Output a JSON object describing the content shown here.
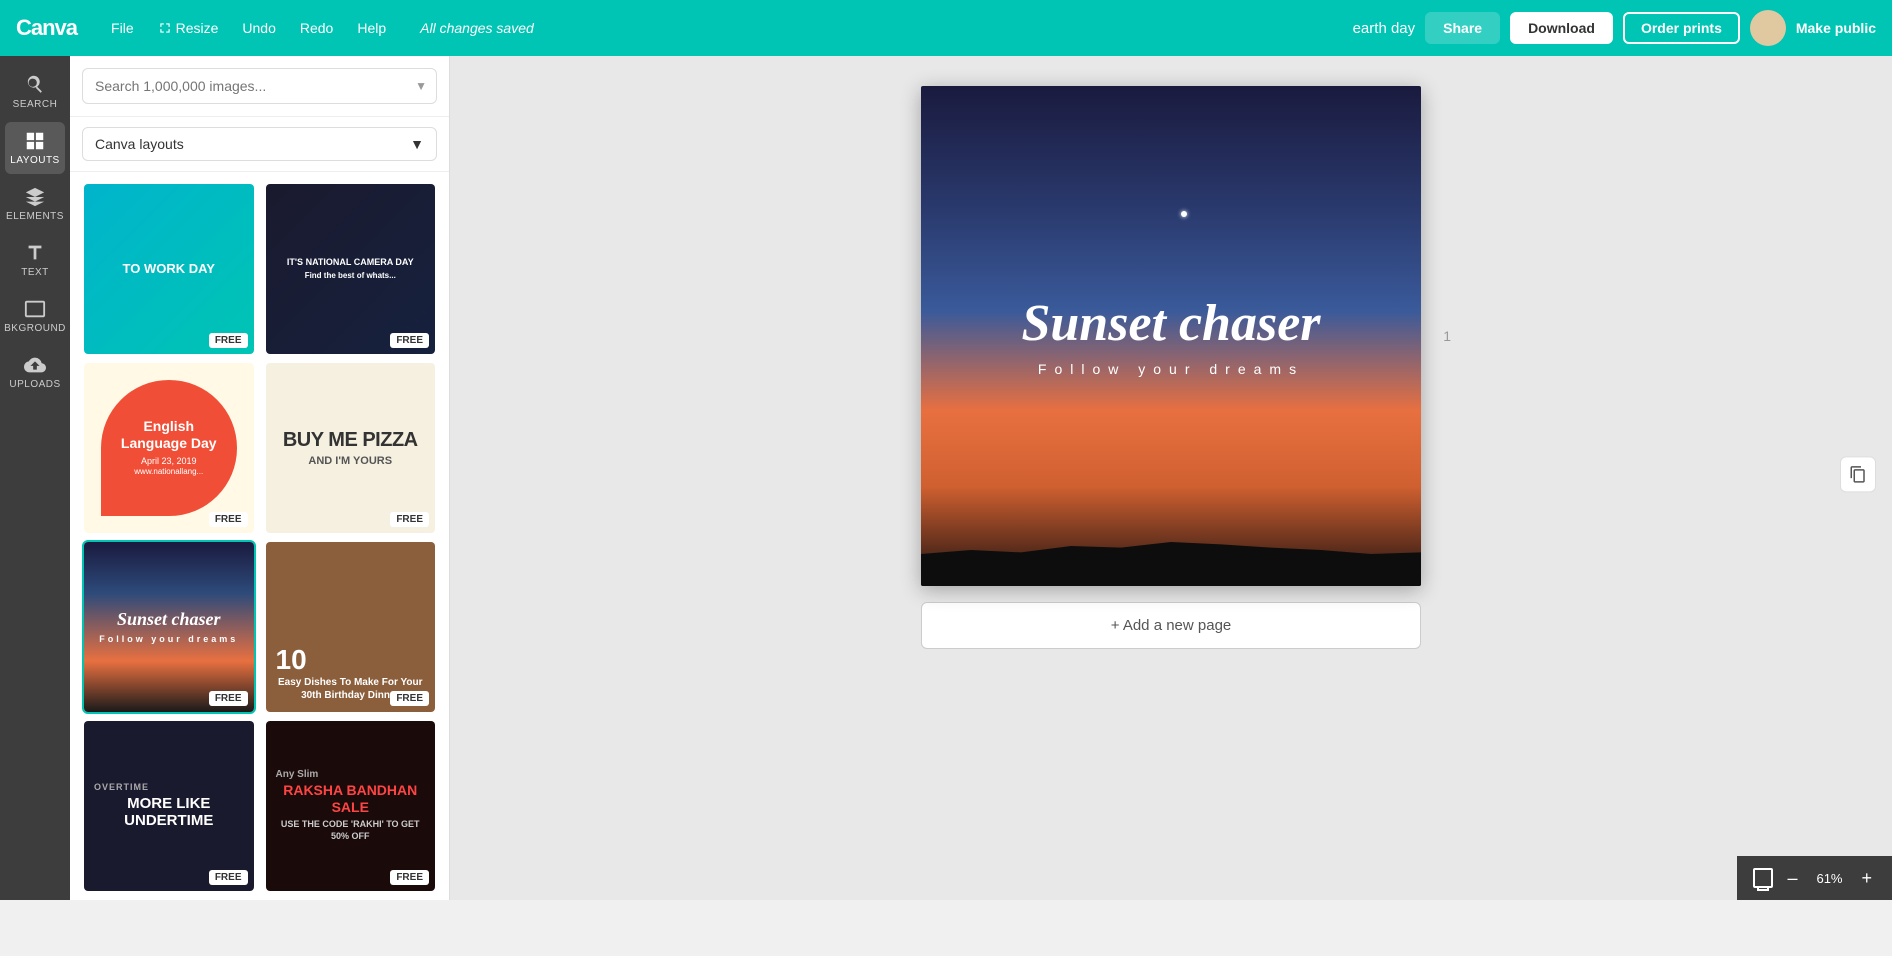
{
  "topbar": {
    "logo": "Canva",
    "nav": {
      "file": "File",
      "resize": "Resize",
      "undo": "Undo",
      "redo": "Redo",
      "help": "Help"
    },
    "saved_text": "All changes saved",
    "project_name": "earth day",
    "share_label": "Share",
    "download_label": "Download",
    "order_label": "Order prints",
    "make_public_label": "Make public"
  },
  "sidebar": {
    "items": [
      {
        "id": "search",
        "label": "SEARCH",
        "icon": "search"
      },
      {
        "id": "layouts",
        "label": "LAYOUTS",
        "icon": "layouts"
      },
      {
        "id": "elements",
        "label": "ELEMENTS",
        "icon": "elements"
      },
      {
        "id": "text",
        "label": "TEXT",
        "icon": "text"
      },
      {
        "id": "background",
        "label": "BKGROUND",
        "icon": "background"
      },
      {
        "id": "uploads",
        "label": "UPLOADS",
        "icon": "uploads"
      }
    ]
  },
  "panel": {
    "search_placeholder": "Search 1,000,000 images...",
    "filter_label": "Canva layouts",
    "templates": [
      {
        "id": "work-day",
        "type": "card-work-day",
        "title": "TO WORK DAY",
        "free": true
      },
      {
        "id": "camera-day",
        "type": "card-camera-day",
        "title": "IT'S NATIONAL CAMERA DAY",
        "free": true
      },
      {
        "id": "english",
        "type": "card-english",
        "title": "English Language Day",
        "subtitle": "April 23, 2019",
        "free": true
      },
      {
        "id": "pizza",
        "type": "card-pizza",
        "title": "BUY ME PIZZA",
        "subtitle": "AND I'M YOURS",
        "free": true
      },
      {
        "id": "sunset",
        "type": "card-sunset",
        "title": "Sunset chaser",
        "subtitle": "Follow your dreams",
        "free": true,
        "selected": true
      },
      {
        "id": "dishes",
        "type": "card-dishes",
        "title": "10 Easy Dishes To Make For Your 30th Birthday Dinner",
        "free": true
      },
      {
        "id": "undertime",
        "type": "card-undertime",
        "title": "MORE LIKE UNDERTIME",
        "free": true
      },
      {
        "id": "raksha",
        "type": "card-raksha",
        "title": "RAKSHA BANDHAN SALE",
        "subtitle": "USE THE CODE 'RAKHI' TO GET 50% OFF",
        "free": true
      }
    ]
  },
  "canvas": {
    "title": "Sunset chaser",
    "subtitle": "Follow  your  dreams",
    "add_page_label": "+ Add a new page",
    "page_number": "1"
  },
  "zoom": {
    "level": "61%",
    "minus_label": "–",
    "plus_label": "+"
  }
}
